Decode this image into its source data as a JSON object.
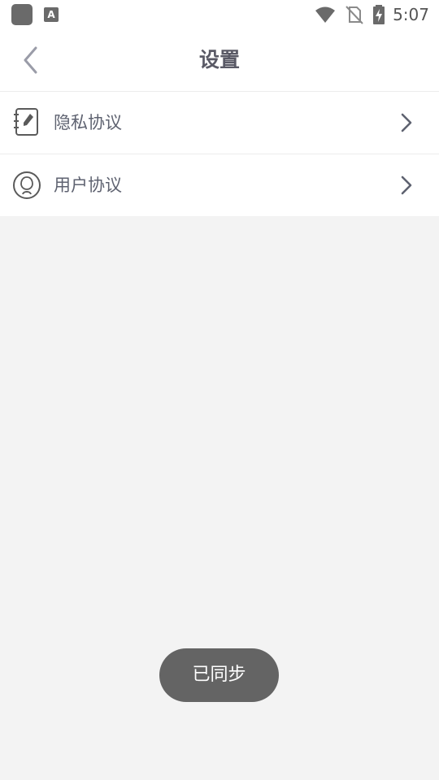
{
  "status_bar": {
    "time": "5:07",
    "notification_icons": [
      "app-square-icon",
      "a-box-icon"
    ],
    "system_icons": [
      "wifi-icon",
      "no-sim-icon",
      "battery-charging-icon"
    ]
  },
  "header": {
    "title": "设置",
    "back_icon": "chevron-left-icon"
  },
  "settings": {
    "items": [
      {
        "label": "隐私协议",
        "icon": "notebook-pen-icon"
      },
      {
        "label": "用户协议",
        "icon": "user-badge-icon"
      }
    ]
  },
  "toast": {
    "text": "已同步"
  },
  "colors": {
    "background": "#f3f3f3",
    "surface": "#ffffff",
    "title": "#5a5a66",
    "label": "#5e6270",
    "toast_bg": "#646464"
  }
}
